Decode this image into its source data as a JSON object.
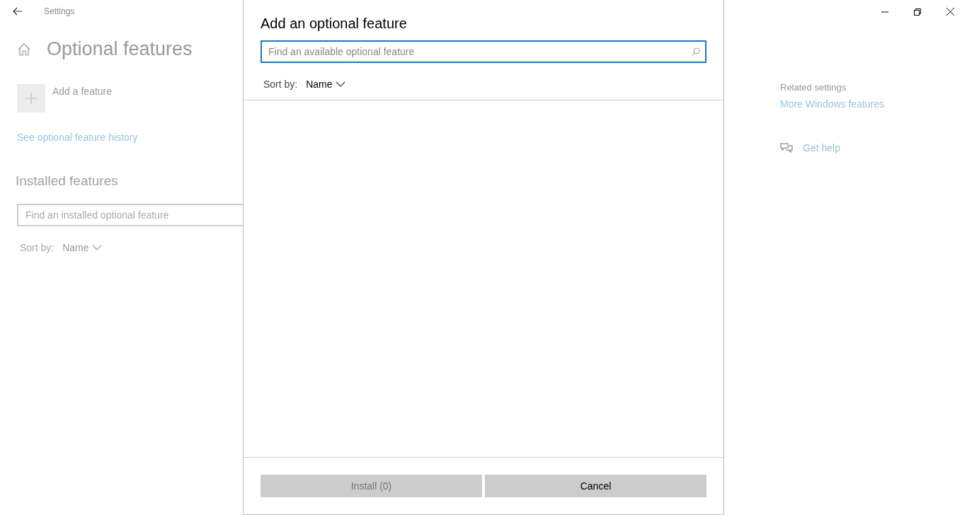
{
  "window": {
    "title": "Settings"
  },
  "page": {
    "title": "Optional features",
    "add_feature": "Add a feature",
    "history_link": "See optional feature history",
    "installed_heading": "Installed features",
    "installed_search": {
      "placeholder": "Find an installed optional feature"
    },
    "sort": {
      "label": "Sort by:",
      "value": "Name"
    }
  },
  "related": {
    "heading": "Related settings",
    "link": "More Windows features",
    "help": "Get help"
  },
  "dialog": {
    "title": "Add an optional feature",
    "search": {
      "placeholder": "Find an available optional feature"
    },
    "sort": {
      "label": "Sort by:",
      "value": "Name"
    },
    "buttons": [
      {
        "label": "Install (0)",
        "disabled": true
      },
      {
        "label": "Cancel",
        "disabled": false
      }
    ]
  }
}
